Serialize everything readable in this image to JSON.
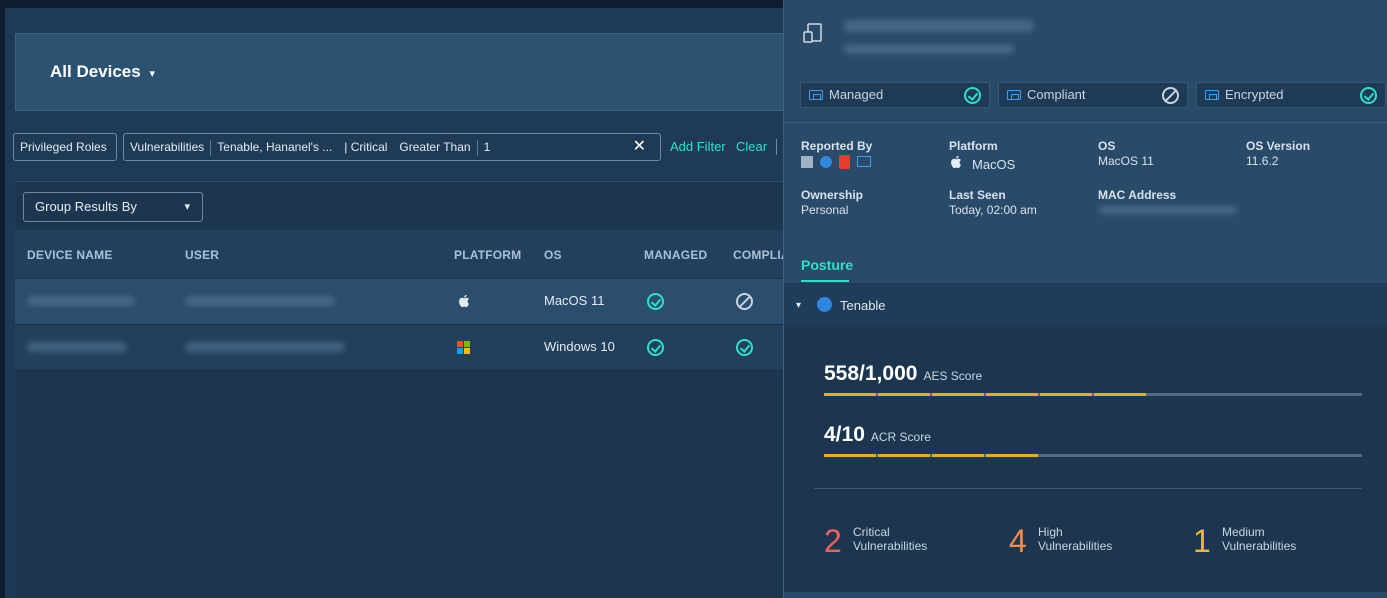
{
  "left": {
    "title": "All Devices",
    "title_caret": "▾",
    "filters": {
      "privileged_roles": "Privileged Roles",
      "vuln_label": "Vulnerabilities",
      "vuln_source": "Tenable, Hananel's ...",
      "vuln_severity": "| Critical",
      "vuln_operator": "Greater Than",
      "vuln_value": "1",
      "clear_x": "✕",
      "add_filter": "Add Filter",
      "clear": "Clear"
    },
    "group_by": {
      "label": "Group Results By",
      "caret": "▾"
    },
    "columns": [
      "DEVICE NAME",
      "USER",
      "PLATFORM",
      "OS",
      "MANAGED",
      "COMPLIA"
    ],
    "rows": [
      {
        "platform_icon": "apple-icon",
        "os": "MacOS 11",
        "managed": "check-circle-icon",
        "compliant": "not-applicable-icon"
      },
      {
        "platform_icon": "windows-icon",
        "os": "Windows 10",
        "managed": "check-circle-icon",
        "compliant": "check-circle-icon"
      }
    ]
  },
  "panel": {
    "status": [
      {
        "label": "Managed",
        "state": "check-circle-icon"
      },
      {
        "label": "Compliant",
        "state": "not-applicable-icon"
      },
      {
        "label": "Encrypted",
        "state": "check-circle-icon"
      }
    ],
    "fields": {
      "reported_by_label": "Reported By",
      "platform_label": "Platform",
      "platform_value": "MacOS",
      "os_label": "OS",
      "os_value": "MacOS 11",
      "os_version_label": "OS Version",
      "os_version_value": "11.6.2",
      "ownership_label": "Ownership",
      "ownership_value": "Personal",
      "last_seen_label": "Last Seen",
      "last_seen_value": "Today, 02:00 am",
      "mac_label": "MAC Address"
    },
    "posture_tab": "Posture",
    "integration": {
      "caret": "▾",
      "name": "Tenable"
    },
    "aes": {
      "value": "558/1,000",
      "label": "AES Score",
      "fraction": 0.558
    },
    "acr": {
      "value": "4/10",
      "label": "ACR Score",
      "fraction": 0.4
    },
    "vulns": [
      {
        "count": "2",
        "line1": "Critical",
        "line2": "Vulnerabilities",
        "color": "#f0605d"
      },
      {
        "count": "4",
        "line1": "High",
        "line2": "Vulnerabilities",
        "color": "#f28c4a"
      },
      {
        "count": "1",
        "line1": "Medium",
        "line2": "Vulnerabilities",
        "color": "#f5b62a"
      }
    ],
    "colors": {
      "accent": "#2de0c8",
      "score_bar": "#f5a623",
      "panel_bg": "#2a4a69"
    }
  }
}
